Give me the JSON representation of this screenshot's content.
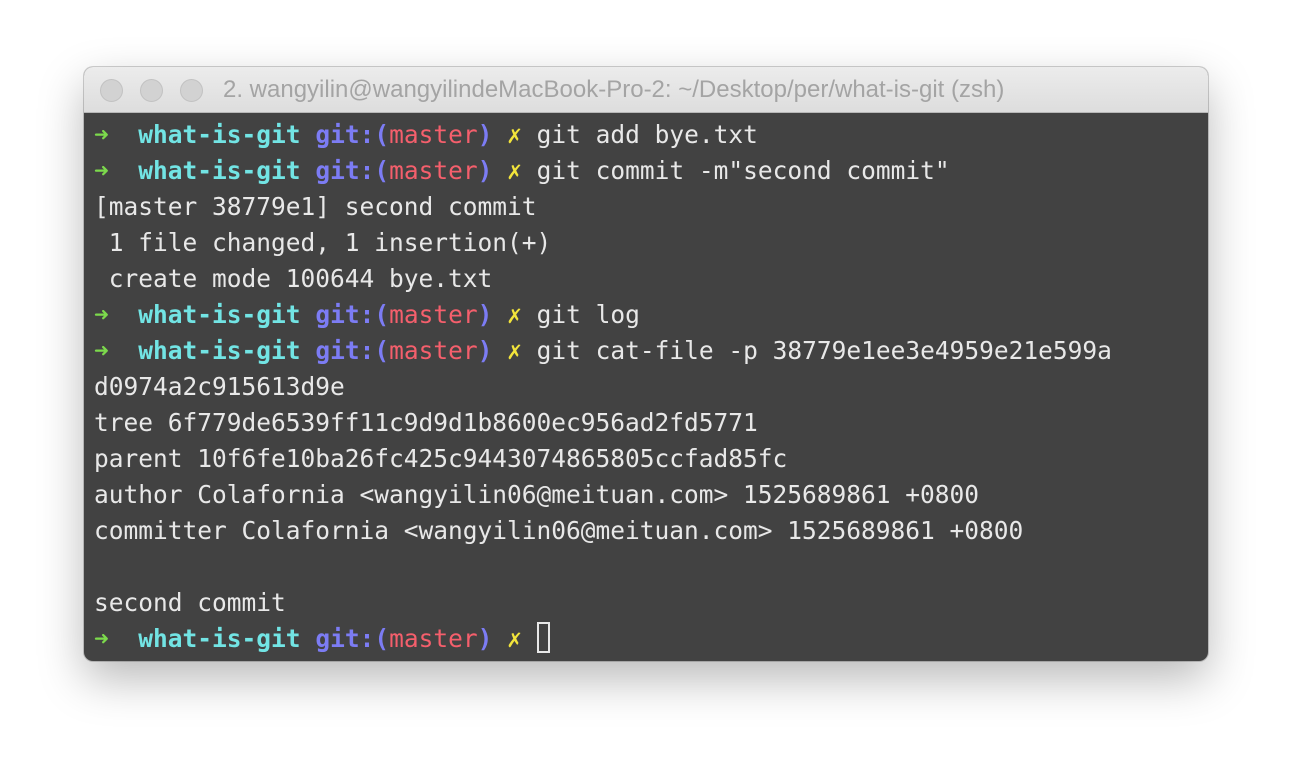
{
  "window": {
    "title": "2. wangyilin@wangyilindeMacBook-Pro-2: ~/Desktop/per/what-is-git (zsh)"
  },
  "prompt": {
    "arrow": "➜",
    "directory": "what-is-git",
    "git_prefix": "git:(",
    "branch": "master",
    "git_suffix": ")",
    "dirty": "✗"
  },
  "terminal": {
    "lines": [
      {
        "type": "prompt",
        "command": "git add bye.txt"
      },
      {
        "type": "prompt",
        "command": "git commit -m\"second commit\""
      },
      {
        "type": "output",
        "text": "[master 38779e1] second commit"
      },
      {
        "type": "output",
        "text": " 1 file changed, 1 insertion(+)"
      },
      {
        "type": "output",
        "text": " create mode 100644 bye.txt"
      },
      {
        "type": "prompt",
        "command": "git log"
      },
      {
        "type": "prompt",
        "command": "git cat-file -p 38779e1ee3e4959e21e599a"
      },
      {
        "type": "output",
        "text": "d0974a2c915613d9e"
      },
      {
        "type": "output",
        "text": "tree 6f779de6539ff11c9d9d1b8600ec956ad2fd5771"
      },
      {
        "type": "output",
        "text": "parent 10f6fe10ba26fc425c9443074865805ccfad85fc"
      },
      {
        "type": "output",
        "text": "author Colafornia <wangyilin06@meituan.com> 1525689861 +0800"
      },
      {
        "type": "output",
        "text": "committer Colafornia <wangyilin06@meituan.com> 1525689861 +0800"
      },
      {
        "type": "output",
        "text": ""
      },
      {
        "type": "output",
        "text": "second commit"
      },
      {
        "type": "prompt",
        "command": "",
        "cursor": true
      }
    ]
  }
}
